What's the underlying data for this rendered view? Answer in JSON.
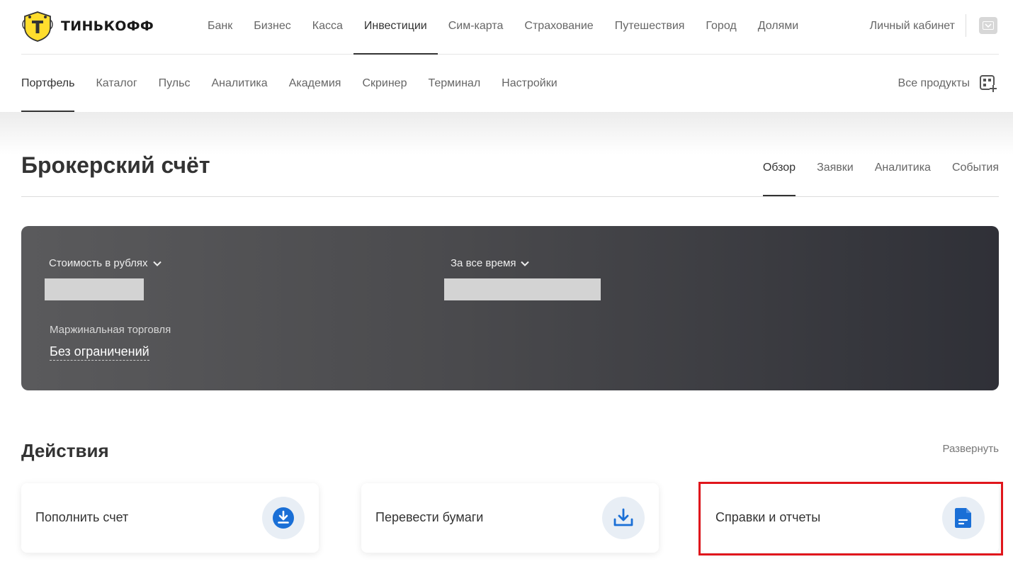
{
  "header": {
    "brand": "ТИНЬКОФФ",
    "nav": [
      {
        "label": "Банк"
      },
      {
        "label": "Бизнес"
      },
      {
        "label": "Касса"
      },
      {
        "label": "Инвестиции",
        "active": true
      },
      {
        "label": "Сим-карта"
      },
      {
        "label": "Страхование"
      },
      {
        "label": "Путешествия"
      },
      {
        "label": "Город"
      },
      {
        "label": "Долями"
      }
    ],
    "cabinet": "Личный кабинет"
  },
  "subnav": {
    "items": [
      {
        "label": "Портфель",
        "active": true
      },
      {
        "label": "Каталог"
      },
      {
        "label": "Пульс"
      },
      {
        "label": "Аналитика"
      },
      {
        "label": "Академия"
      },
      {
        "label": "Скринер"
      },
      {
        "label": "Терминал"
      },
      {
        "label": "Настройки"
      }
    ],
    "all_products": "Все продукты"
  },
  "account": {
    "title": "Брокерский счёт",
    "tabs": [
      {
        "label": "Обзор",
        "active": true
      },
      {
        "label": "Заявки"
      },
      {
        "label": "Аналитика"
      },
      {
        "label": "События"
      }
    ]
  },
  "summary": {
    "value_dropdown": "Стоимость в рублях",
    "period_dropdown": "За все время",
    "margin_label": "Маржинальная торговля",
    "margin_value": "Без ограничений"
  },
  "actions": {
    "title": "Действия",
    "expand": "Развернуть",
    "items": [
      {
        "label": "Пополнить счет",
        "icon": "download-circle-icon"
      },
      {
        "label": "Перевести бумаги",
        "icon": "tray-download-icon"
      },
      {
        "label": "Справки и отчеты",
        "icon": "document-icon"
      }
    ]
  },
  "colors": {
    "accent_blue": "#1a6fd6",
    "highlight_red": "#e0161c",
    "logo_yellow": "#ffdd2d"
  }
}
